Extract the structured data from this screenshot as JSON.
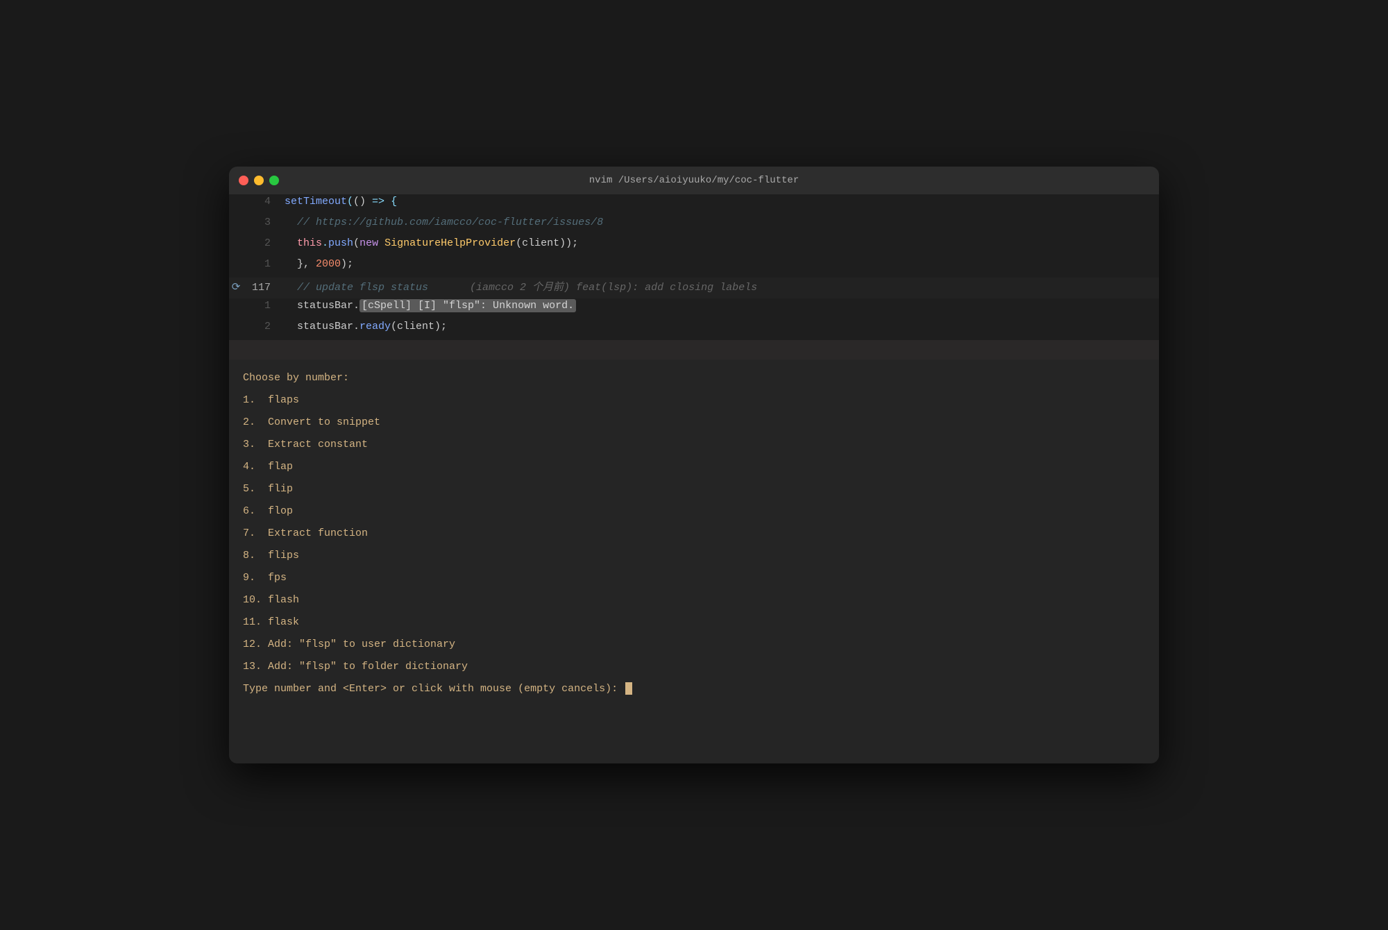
{
  "window": {
    "title": "nvim /Users/aioiyuuko/my/coc-flutter",
    "traffic_lights": [
      "close",
      "minimize",
      "maximize"
    ]
  },
  "editor": {
    "lines": [
      {
        "num": "4",
        "git": "",
        "content": "setTimeout(() => {"
      },
      {
        "num": "3",
        "git": "",
        "content": "  // https://github.com/iamcco/coc-flutter/issues/8"
      },
      {
        "num": "2",
        "git": "",
        "content": "  this.push(new SignatureHelpProvider(client));"
      },
      {
        "num": "1",
        "git": "",
        "content": "  }, 2000);"
      },
      {
        "num": "117",
        "git": "git",
        "content": "  // update flsp status",
        "commit_info": "(iamcco 2 个月前) feat(lsp): add closing labels"
      },
      {
        "num": "1",
        "git": "",
        "content": "  statusBar.[cSpell] [I] \"flsp\": Unknown word."
      },
      {
        "num": "2",
        "git": "",
        "content": "  statusBar.ready(client);"
      }
    ]
  },
  "menu": {
    "header": "Choose by number:",
    "items": [
      "1.  flaps",
      "2.  Convert to snippet",
      "3.  Extract constant",
      "4.  flap",
      "5.  flip",
      "6.  flop",
      "7.  Extract function",
      "8.  flips",
      "9.  fps",
      "10. flash",
      "11. flask",
      "12. Add: \"flsp\" to user dictionary",
      "13. Add: \"flsp\" to folder dictionary"
    ],
    "prompt": "Type number and <Enter> or click with mouse (empty cancels): "
  }
}
